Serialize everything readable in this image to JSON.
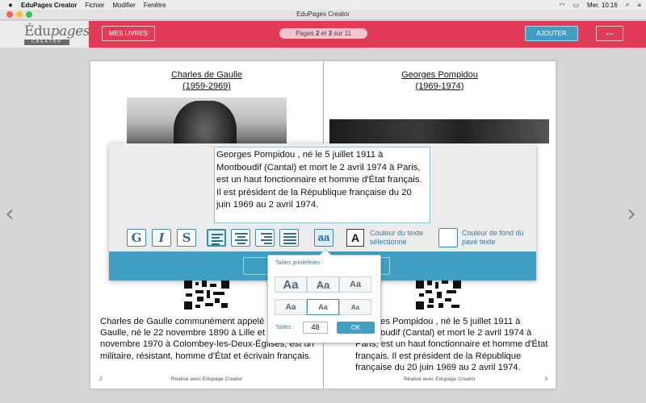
{
  "menubar": {
    "app": "EduPages Creator",
    "items": [
      "Fichier",
      "Modifier",
      "Fenêtre"
    ],
    "clock": "Mer. 10:16"
  },
  "window": {
    "title": "EduPages Creator"
  },
  "logo": {
    "word_a": "Édu",
    "word_b": "pages",
    "sub": "CREATOR"
  },
  "toolbar": {
    "mes_livres": "MES LIVRES",
    "pager_a": "Pages ",
    "pager_p1": "2",
    "pager_mid": " et ",
    "pager_p2": "3",
    "pager_b": " sur 11",
    "ajouter": "AJOUTER",
    "more": "..."
  },
  "nav": {
    "prev": "‹",
    "next": "›"
  },
  "pages": {
    "left": {
      "title_1": "Charles de Gaulle",
      "title_2": "(1959-2969)",
      "body": "Charles de Gaulle communément appelé général de Gaulle, né le 22 novembre 1890 à Lille et mort le 9 novembre 1970 à Colombey-les-Deux-Églises, est un militaire, résistant, homme d'État et écrivain français.",
      "page_num": "2",
      "footer": "Réalisé avec Edupage Creator"
    },
    "right": {
      "title_1": "Georges Pompidou",
      "title_2": "(1969-1974)",
      "body": "Georges Pompidou , né le 5 juillet 1911 à Montboudif (Cantal) et mort le 2 avril 1974 à Paris, est un haut fonctionnaire et homme d'État français. Il est président de la République française du 20 juin 1969 au 2 avril 1974.",
      "page_num": "3",
      "footer": "Réalisé avec Edupage Creator"
    }
  },
  "editor": {
    "text": "Georges Pompidou , né le 5 juillet 1911 à Montboudif (Cantal) et mort le 2 avril 1974 à Paris, est un haut fonctionnaire et homme d'État français. Il est président de la République française du 20 juin 1969 au 2 avril 1974.",
    "bold": "G",
    "italic": "I",
    "strike": "S",
    "size_icon": "aa",
    "color_letter": "A",
    "text_color_label": "Couleur du texte sélectionné",
    "bg_color_label": "Couleur de fond du pavé texte"
  },
  "size_popover": {
    "title": "Tailles prédéfinies :",
    "preset_label": "Aa",
    "size_label": "Tailles :",
    "size_value": "48",
    "ok": "OK"
  }
}
